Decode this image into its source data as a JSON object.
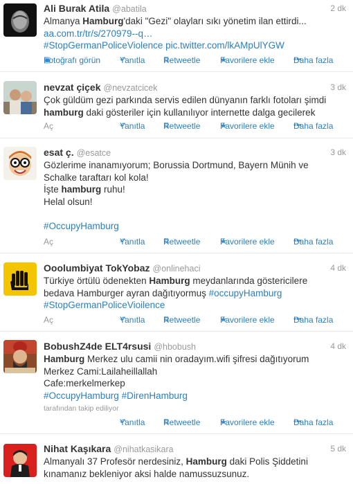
{
  "labels": {
    "reply": "Yanıtla",
    "retweet": "Retweetle",
    "favorite": "Favorilere ekle",
    "more": "Daha fazla",
    "expand": "Aç",
    "view_photo": "Fotoğrafı görün"
  },
  "tweets": [
    {
      "name": "Ali Burak Atila",
      "handle": "@abatila",
      "time": "2 dk",
      "t1a": "Almanya ",
      "t1b": "Hamburg",
      "t1c": "'daki \"Gezi\" olayları sıkı yönetim ilan ettirdi...",
      "t2": "aa.com.tr/tr/s/270979--q…",
      "t3a": "#StopGermanPoliceViolence",
      "t3b": "pic.twitter.com/lkAMpUlYGW"
    },
    {
      "name": "nevzat çiçek",
      "handle": "@nevzatcicek",
      "time": "3 dk",
      "t1": "Çok güldüm gezi parkında servis edilen dünyanın farklı fotoları şimdi",
      "t2a": "hamburg",
      "t2b": " daki gösteriler için kullanılıyor internette dalga gecilerek"
    },
    {
      "name": "esat ç.",
      "handle": "@esatce",
      "time": "3 dk",
      "t1": "Gözlerime inanamıyorum; Borussia Dortmund, Bayern Münih ve",
      "t2": "Schalke taraftarı kol kola!",
      "t3a": "İşte ",
      "t3b": "hamburg",
      "t3c": " ruhu!",
      "t4": "Helal olsun!",
      "t5": "#OccupyHamburg"
    },
    {
      "name": "Ooolumbiyat TokYobaz",
      "handle": "@onlinehaci",
      "time": "4 dk",
      "t1a": "Türkiye örtülü ödenekten ",
      "t1b": "Hamburg",
      "t1c": " meydanlarında göstericilere",
      "t2a": "bedava Hamburger ayran dağıtıyormuş ",
      "t2b": "#occupyHamburg",
      "t3": "#StopGermanPoliceVioilence"
    },
    {
      "name": "BobushZ4de ELT4rsusi",
      "handle": "@hbobush",
      "time": "4 dk",
      "t1a": "Hamburg",
      "t1b": " Merkez ulu camii nin oradayım.wifi şifresi dağıtıyorum",
      "t2": "Merkez Cami:Lailaheillallah",
      "t3": "Cafe:merkelmerkep",
      "t4a": "#OccupyHamburg",
      "t4b": "#DirenHamburg",
      "followed": "tarafından takip ediliyor"
    },
    {
      "name": "Nihat Kaşıkara",
      "handle": "@nihatkasikara",
      "time": "5 dk",
      "t1a": "Almanyalı 37 Profesör nerdesiniz, ",
      "t1b": "Hamburg",
      "t1c": " daki Polis Şiddetini",
      "t2": "kınamanız bekleniyor aksi halde namussuzsunuz."
    }
  ],
  "colors": {
    "link": "#2a7fbf",
    "text": "#333333",
    "meta": "#999999",
    "divider": "#e8e8e8"
  },
  "icons": [
    "photo-icon",
    "reply-icon",
    "retweet-icon",
    "star-icon",
    "more-dots-icon"
  ]
}
